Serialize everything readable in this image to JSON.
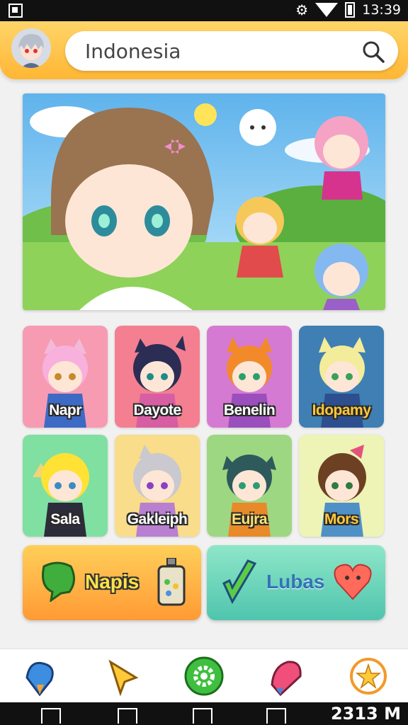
{
  "status_bar": {
    "time": "13:39"
  },
  "search": {
    "value": "Indonesia"
  },
  "characters": [
    {
      "name": "Napr",
      "bg": "#f79bb2"
    },
    {
      "name": "Dayote",
      "bg": "#f47f91"
    },
    {
      "name": "Benelin",
      "bg": "#d57ad2"
    },
    {
      "name": "Idopamy",
      "bg": "#3f7fb3"
    },
    {
      "name": "Sala",
      "bg": "#7fe0a2"
    },
    {
      "name": "Gakleiph",
      "bg": "#f9dd8a"
    },
    {
      "name": "Eujra",
      "bg": "#9ed782"
    },
    {
      "name": "Mors",
      "bg": "#eef3b6"
    }
  ],
  "actions": [
    {
      "label": "Napis"
    },
    {
      "label": "Lubas"
    }
  ],
  "system_bar": {
    "time": "2313 M"
  },
  "colors": {
    "header": "#ffc34a",
    "accent_green": "#4cc24f"
  }
}
